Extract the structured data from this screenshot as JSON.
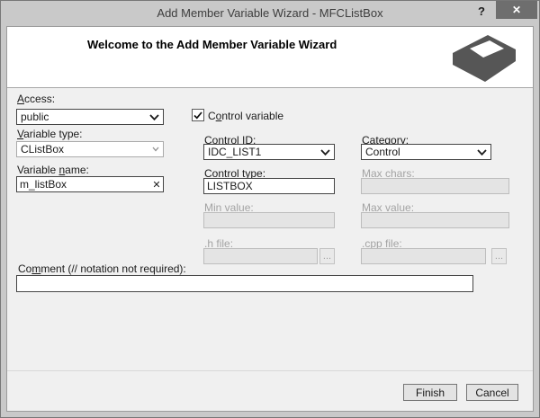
{
  "window": {
    "title": "Add Member Variable Wizard - MFCListBox",
    "help": "?"
  },
  "icons": {
    "close": "✕",
    "clear": "✕"
  },
  "header": {
    "welcome": "Welcome to the Add Member Variable Wizard"
  },
  "form": {
    "access": {
      "label": {
        "pre": "",
        "key": "A",
        "post": "ccess:"
      },
      "value": "public"
    },
    "variable_type": {
      "label": {
        "pre": "",
        "key": "V",
        "post": "ariable type:"
      },
      "value": "CListBox"
    },
    "variable_name": {
      "label": {
        "pre": "Variable ",
        "key": "n",
        "post": "ame:"
      },
      "value": "m_listBox"
    },
    "control_variable": {
      "label": {
        "pre": "C",
        "key": "o",
        "post": "ntrol variable"
      },
      "checked": true
    },
    "control_id": {
      "label": {
        "pre": "Control ",
        "key": "ID",
        "post": ":"
      },
      "value": "IDC_LIST1"
    },
    "control_type": {
      "label": {
        "pre": "Control t",
        "key": "y",
        "post": "pe:"
      },
      "value": "LISTBOX"
    },
    "category": {
      "label": {
        "pre": "Ca",
        "key": "t",
        "post": "egory:"
      },
      "value": "Control"
    },
    "max_chars": {
      "label": {
        "pre": "Ma",
        "key": "x",
        "post": " chars:"
      },
      "value": "",
      "disabled": true
    },
    "min_value": {
      "label": {
        "pre": "Min val",
        "key": "u",
        "post": "e:"
      },
      "value": "",
      "disabled": true
    },
    "max_value": {
      "label": {
        "pre": "Max valu",
        "key": "e",
        "post": ":"
      },
      "value": "",
      "disabled": true
    },
    "h_file": {
      "label": {
        "pre": ".h ",
        "key": "f",
        "post": "ile:"
      },
      "value": "",
      "browse": "...",
      "disabled": true
    },
    "cpp_file": {
      "label": {
        "pre": ".cp",
        "key": "p",
        "post": " file:"
      },
      "value": "",
      "browse": "...",
      "disabled": true
    },
    "comment": {
      "label": {
        "pre": "Co",
        "key": "m",
        "post": "ment (// notation not required):"
      },
      "value": ""
    }
  },
  "footer": {
    "finish": "Finish",
    "cancel": "Cancel"
  }
}
